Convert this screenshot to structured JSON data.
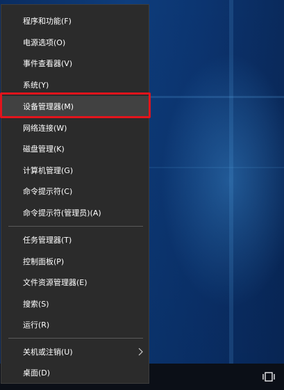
{
  "menu": {
    "items": [
      {
        "label": "程序和功能(F)"
      },
      {
        "label": "电源选项(O)"
      },
      {
        "label": "事件查看器(V)"
      },
      {
        "label": "系统(Y)"
      },
      {
        "label": "设备管理器(M)",
        "highlighted": true
      },
      {
        "label": "网络连接(W)"
      },
      {
        "label": "磁盘管理(K)"
      },
      {
        "label": "计算机管理(G)"
      },
      {
        "label": "命令提示符(C)"
      },
      {
        "label": "命令提示符(管理员)(A)"
      },
      {
        "label": "任务管理器(T)"
      },
      {
        "label": "控制面板(P)"
      },
      {
        "label": "文件资源管理器(E)"
      },
      {
        "label": "搜索(S)"
      },
      {
        "label": "运行(R)"
      },
      {
        "label": "关机或注销(U)",
        "has_submenu": true
      },
      {
        "label": "桌面(D)"
      }
    ]
  },
  "highlight_color": "#e3141c",
  "icons": {
    "submenu": "chevron-right-icon",
    "action_center": "action-center-icon"
  }
}
